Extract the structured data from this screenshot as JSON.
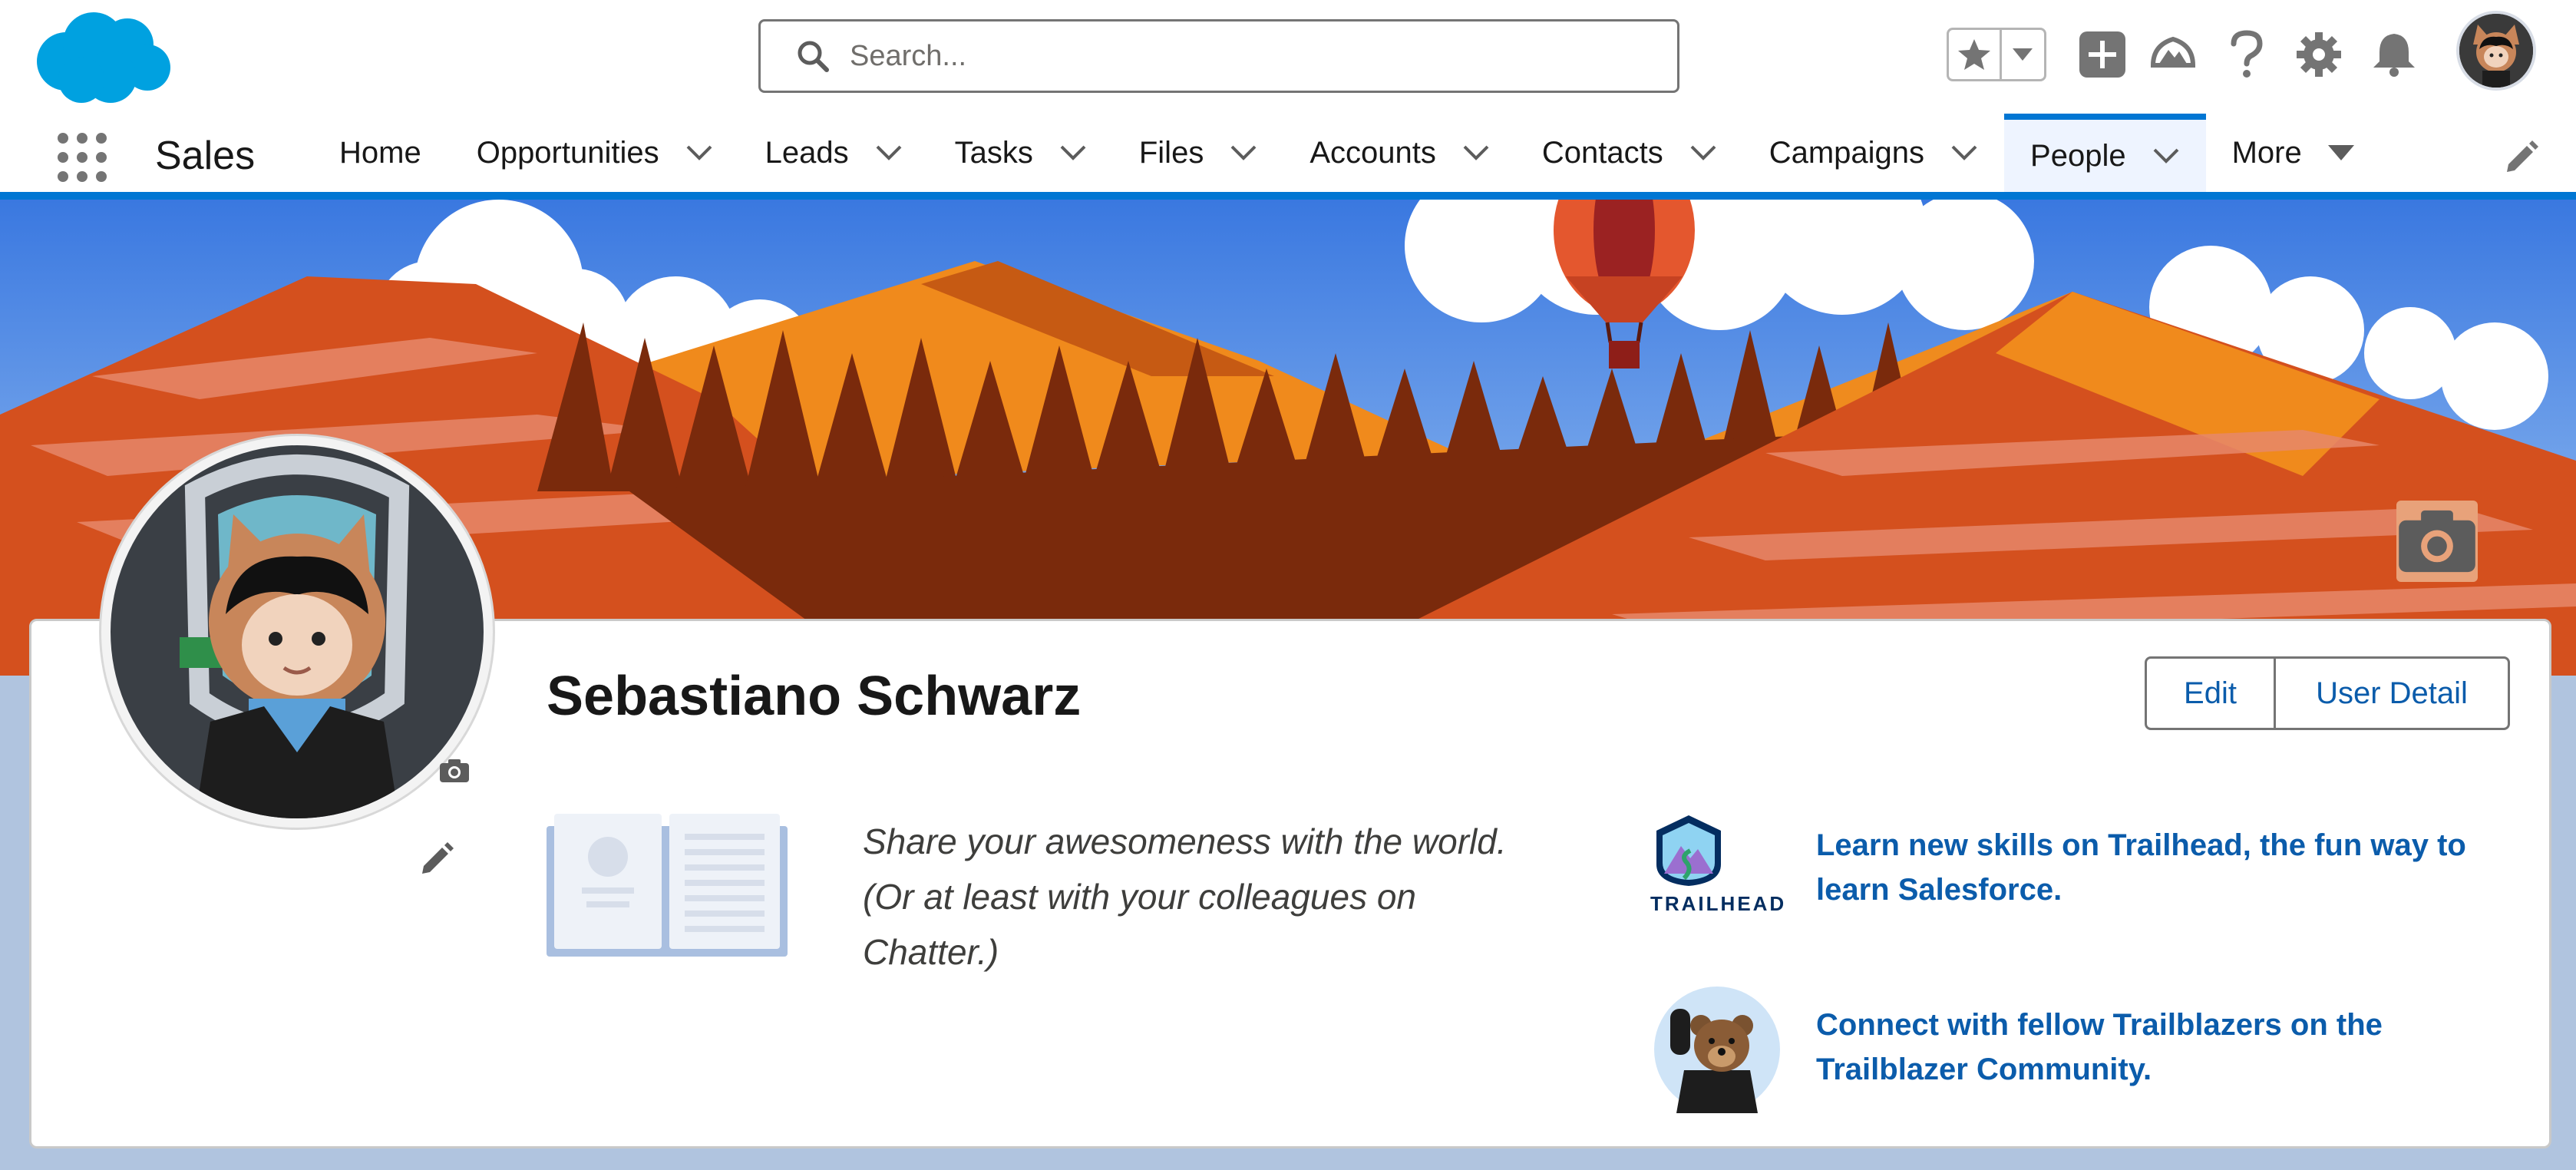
{
  "header": {
    "search_placeholder": "Search...",
    "icons": [
      "salesforce-cloud-logo",
      "search-icon",
      "favorites-star-icon",
      "favorites-menu-chevron-icon",
      "global-actions-plus-icon",
      "trailhead-guidance-icon",
      "help-icon",
      "setup-gear-icon",
      "notifications-bell-icon",
      "user-avatar"
    ]
  },
  "nav": {
    "app_name": "Sales",
    "items": [
      {
        "label": "Home",
        "has_menu": false
      },
      {
        "label": "Opportunities",
        "has_menu": true
      },
      {
        "label": "Leads",
        "has_menu": true
      },
      {
        "label": "Tasks",
        "has_menu": true
      },
      {
        "label": "Files",
        "has_menu": true
      },
      {
        "label": "Accounts",
        "has_menu": true
      },
      {
        "label": "Contacts",
        "has_menu": true
      },
      {
        "label": "Campaigns",
        "has_menu": true
      },
      {
        "label": "People",
        "has_menu": true,
        "active": true
      }
    ],
    "more_label": "More"
  },
  "profile": {
    "name": "Sebastiano Schwarz",
    "edit_label": "Edit",
    "user_detail_label": "User Detail",
    "about_text": "Share your awesomeness with the world. (Or at least with your colleagues on Chatter.)",
    "trailhead_wordmark": "TRAILHEAD",
    "trailhead_link": "Learn new skills on Trailhead, the fun way to learn Salesforce.",
    "community_link": "Connect with fellow Trailblazers on the Trailblazer Community."
  },
  "colors": {
    "brand_blue": "#0176d3",
    "link_blue": "#0b5cab",
    "salesforce_cloud": "#00a1e0",
    "banner_sky": "#5b95e8",
    "banner_mountain": "#d4501e"
  }
}
